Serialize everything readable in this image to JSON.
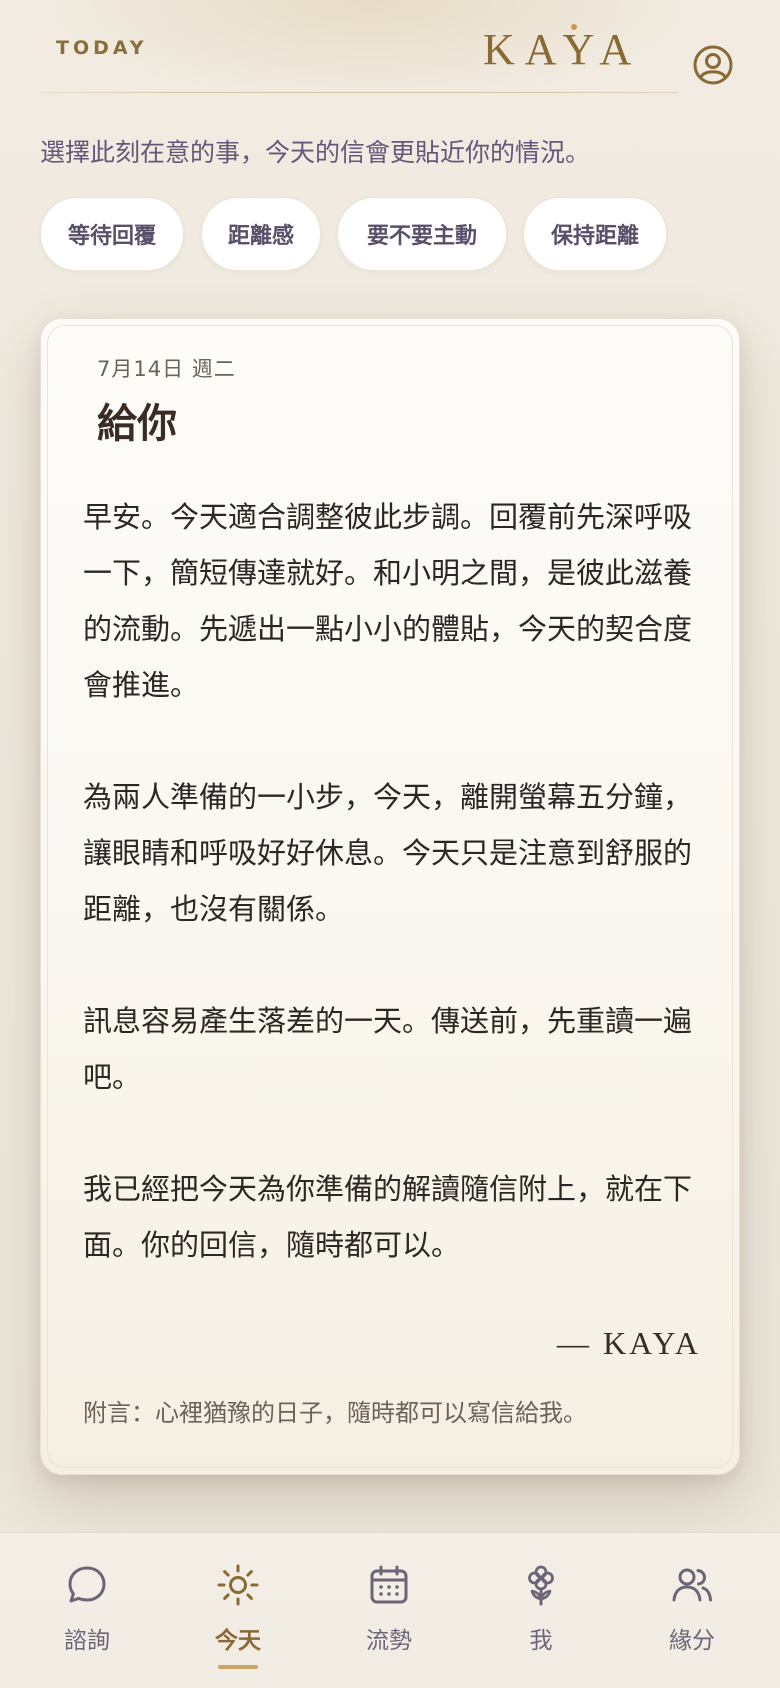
{
  "header": {
    "section_label": "TODAY",
    "brand": "KAYA",
    "profile_icon": "user-circle-icon"
  },
  "prompt": "選擇此刻在意的事，今天的信會更貼近你的情況。",
  "chips": [
    {
      "label": "等待回覆"
    },
    {
      "label": "距離感"
    },
    {
      "label": "要不要主動"
    },
    {
      "label": "保持距離"
    }
  ],
  "letter": {
    "date": "7月14日 週二",
    "title": "給你",
    "paragraphs": [
      "早安。今天適合調整彼此步調。回覆前先深呼吸一下，簡短傳達就好。和小明之間，是彼此滋養的流動。先遞出一點小小的體貼，今天的契合度會推進。",
      "為兩人準備的一小步，今天，離開螢幕五分鐘，讓眼睛和呼吸好好休息。今天只是注意到舒服的距離，也沒有關係。",
      "訊息容易產生落差的一天。傳送前，先重讀一遍吧。",
      "我已經把今天為你準備的解讀隨信附上，就在下面。你的回信，隨時都可以。"
    ],
    "signature": "— KAYA",
    "postscript": "附言：心裡猶豫的日子，隨時都可以寫信給我。"
  },
  "nav": {
    "items": [
      {
        "label": "諮詢",
        "icon": "chat-bubble-icon",
        "active": false
      },
      {
        "label": "今天",
        "icon": "sun-icon",
        "active": true
      },
      {
        "label": "流勢",
        "icon": "calendar-icon",
        "active": false
      },
      {
        "label": "我",
        "icon": "flower-icon",
        "active": false
      },
      {
        "label": "緣分",
        "icon": "users-icon",
        "active": false
      }
    ]
  },
  "colors": {
    "accent_gold": "#8a6a34",
    "nav_inactive": "#6e6478",
    "background": "#efe9df"
  }
}
